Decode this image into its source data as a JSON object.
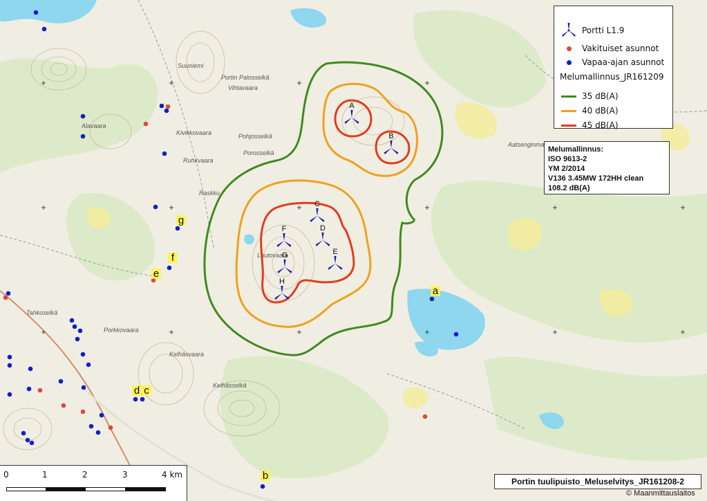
{
  "legend": {
    "turbine_label": "Portti L1.9",
    "permanent_label": "Vakituiset asunnot",
    "holiday_label": "Vapaa-ajan asunnot",
    "model_title": "Melumallinnus_JR161209",
    "contours": [
      {
        "label": "35 dB(A)",
        "color": "#3f8a1f"
      },
      {
        "label": "40 dB(A)",
        "color": "#f0a01f"
      },
      {
        "label": "45 dB(A)",
        "color": "#e23c1c"
      }
    ]
  },
  "colors": {
    "turbine": "#1a1ab0",
    "permanent": "#e0483a",
    "holiday": "#1020c8",
    "water": "#8ed6ef",
    "forest": "#d6e7c2",
    "bog": "#f2ec9a"
  },
  "info": {
    "line1": "Melumallinnus:",
    "line2": "ISO 9613-2",
    "line3": "YM 2/2014",
    "line4": "V136 3.45MW 172HH clean",
    "line5": "108.2 dB(A)"
  },
  "turbines": [
    "A",
    "B",
    "C",
    "D",
    "E",
    "F",
    "G",
    "H"
  ],
  "receptors": [
    "a",
    "b",
    "c",
    "d",
    "e",
    "f",
    "g"
  ],
  "scale": {
    "labels": [
      "0",
      "1",
      "2",
      "3",
      "4 km"
    ]
  },
  "map_title": "Portin tuulipuisto_Meluselvitys_JR161208-2",
  "copyright": "© Maanmittauslaitos",
  "place_names": [
    "Vihtavaara",
    "Portin Palosselkä",
    "Kivikkovaara",
    "Lautovaara",
    "Pohjosselkä",
    "Porosselkä",
    "Kelhäsvaara",
    "Kelhässelkä",
    "Aatsenginmaa",
    "Suuniemi",
    "Tahkoselkä",
    "Porkkovaara",
    "Alavaara",
    "Raskku",
    "Ruhkvaara"
  ]
}
